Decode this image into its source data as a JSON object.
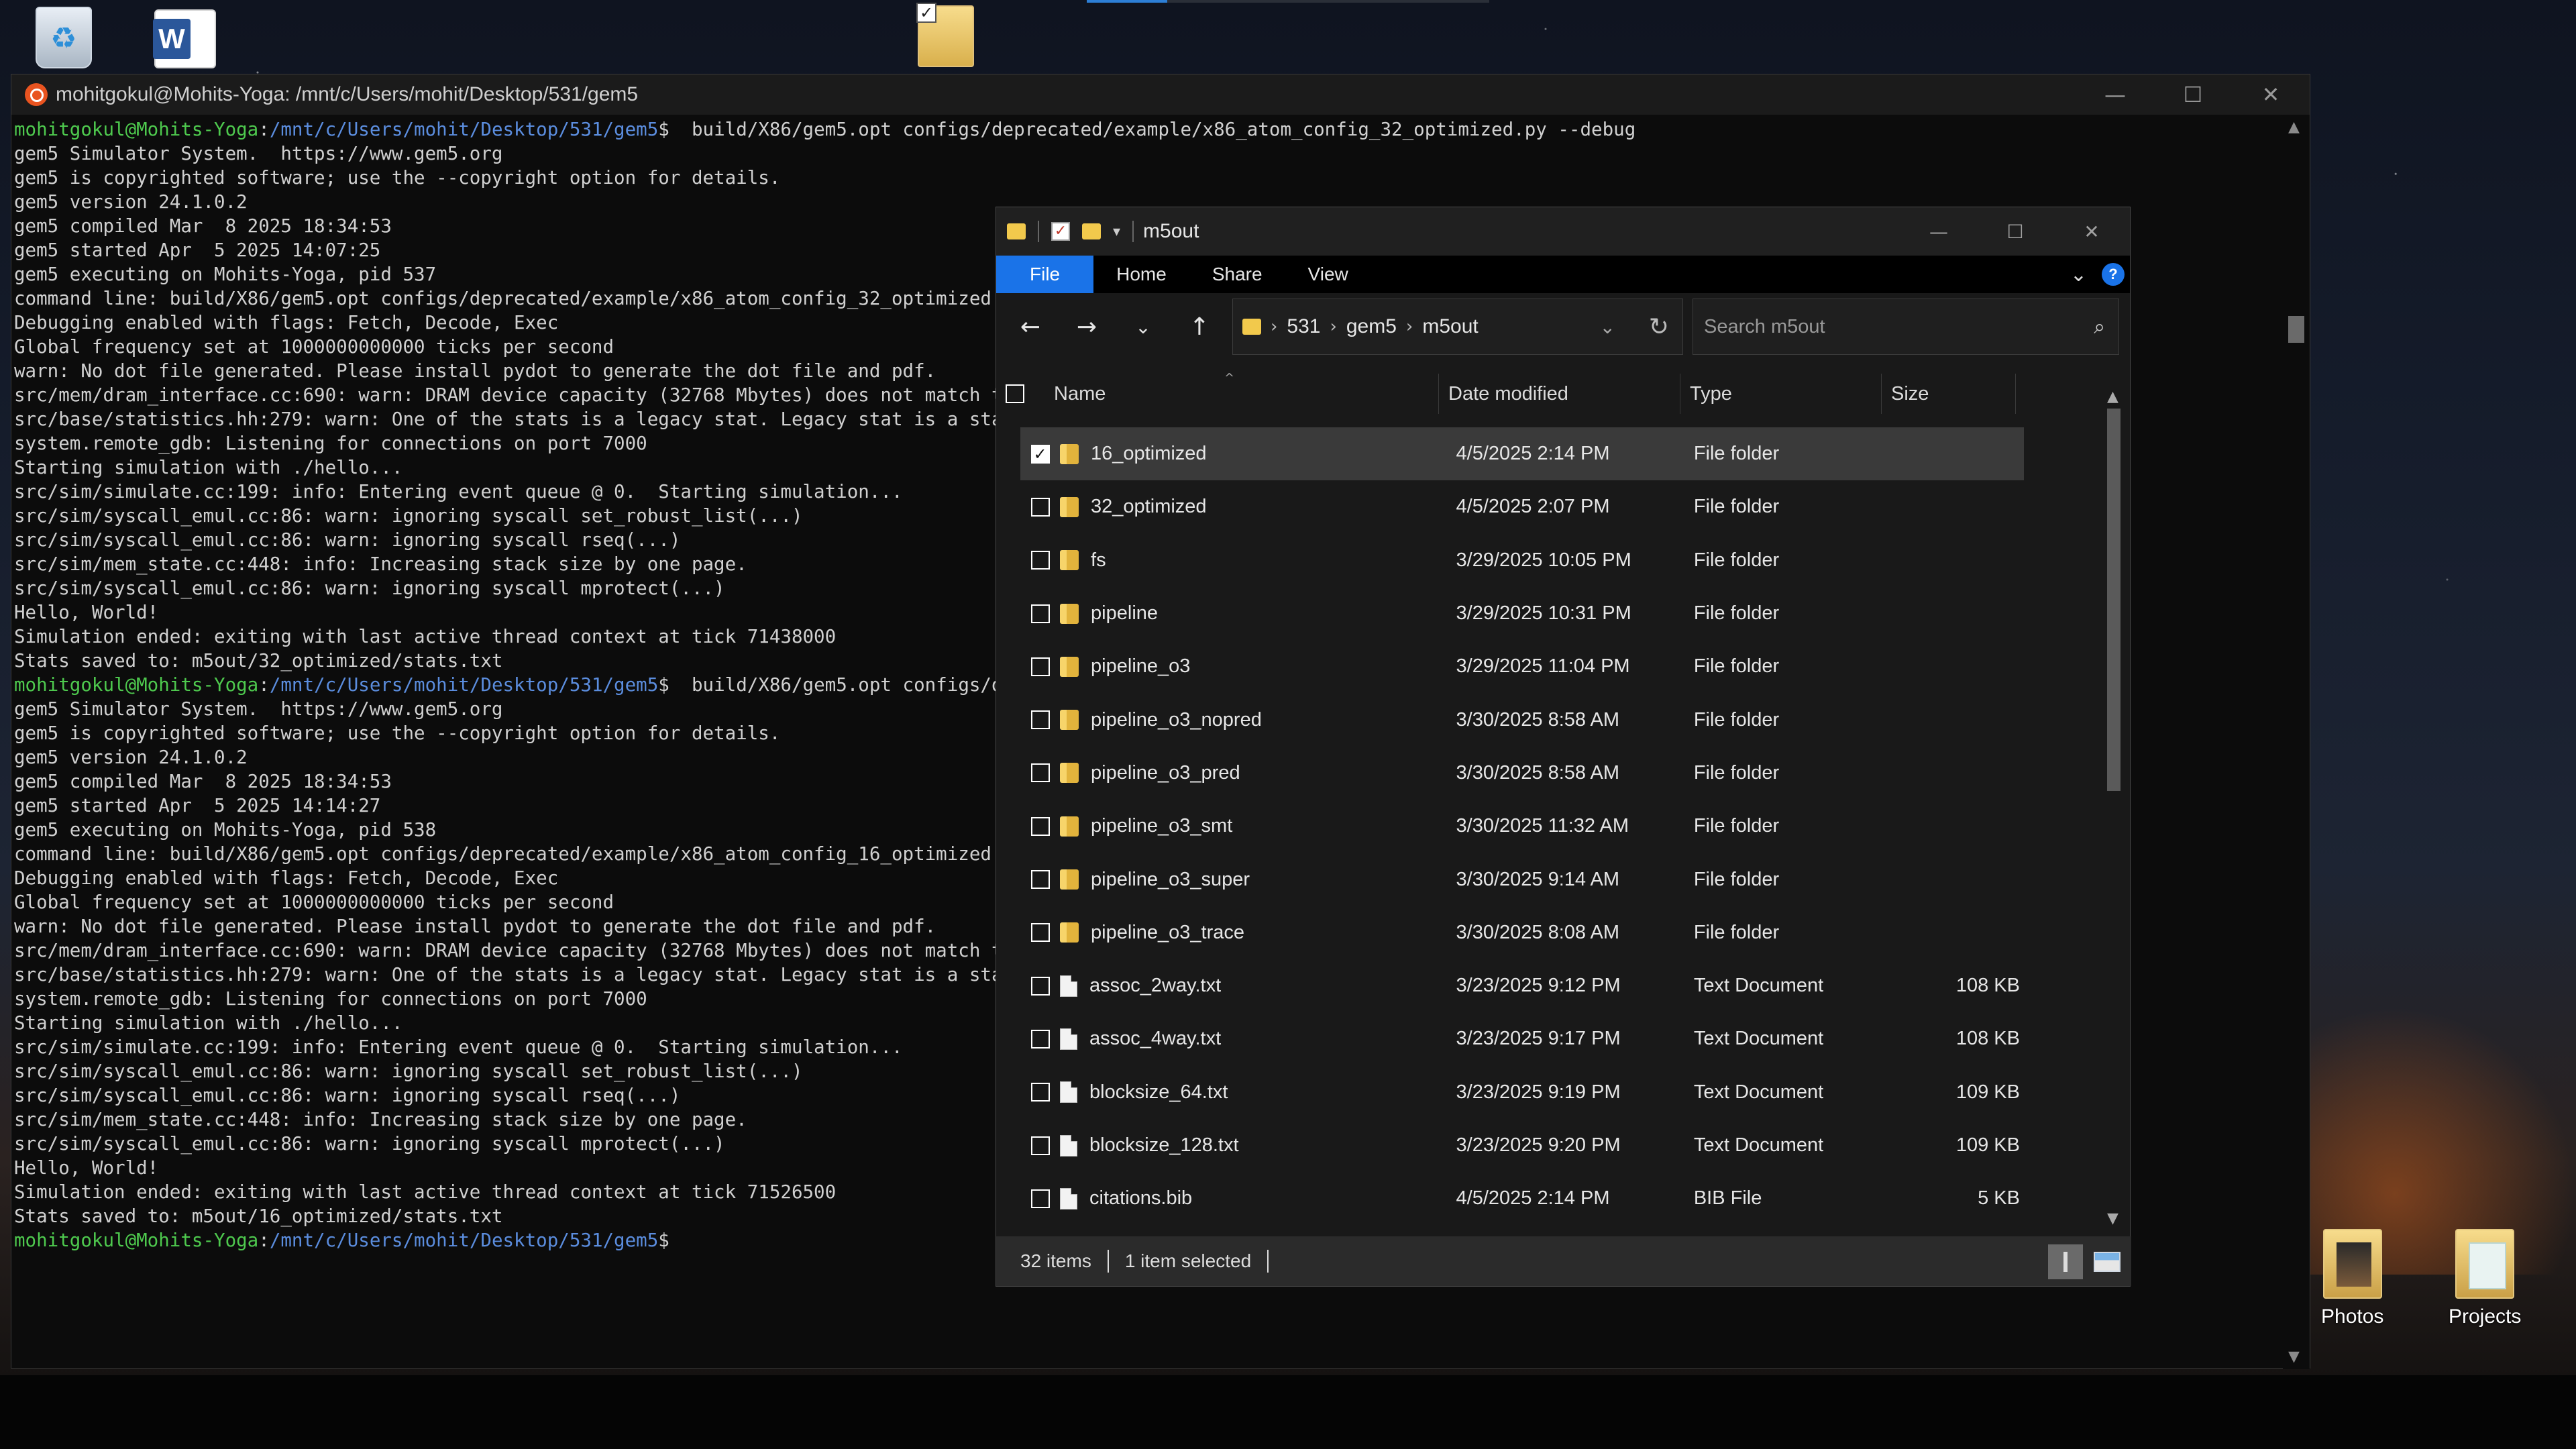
{
  "desktop": {
    "icons": [
      {
        "label": "Photos"
      },
      {
        "label": "Projects"
      }
    ]
  },
  "terminal": {
    "title": "mohitgokul@Mohits-Yoga: /mnt/c/Users/mohit/Desktop/531/gem5",
    "prompt_user": "mohitgokul@Mohits-Yoga",
    "prompt_path": "/mnt/c/Users/mohit/Desktop/531/gem5",
    "lines": [
      {
        "prompt": true,
        "cmd": "$  build/X86/gem5.opt configs/deprecated/example/x86_atom_config_32_optimized.py --debug"
      },
      {
        "text": "gem5 Simulator System.  https://www.gem5.org"
      },
      {
        "text": "gem5 is copyrighted software; use the --copyright option for details."
      },
      {
        "text": ""
      },
      {
        "text": "gem5 version 24.1.0.2"
      },
      {
        "text": "gem5 compiled Mar  8 2025 18:34:53"
      },
      {
        "text": "gem5 started Apr  5 2025 14:07:25"
      },
      {
        "text": "gem5 executing on Mohits-Yoga, pid 537"
      },
      {
        "text": "command line: build/X86/gem5.opt configs/deprecated/example/x86_atom_config_32_optimized.py"
      },
      {
        "text": ""
      },
      {
        "text": "Debugging enabled with flags: Fetch, Decode, Exec"
      },
      {
        "text": "Global frequency set at 1000000000000 ticks per second"
      },
      {
        "text": "warn: No dot file generated. Please install pydot to generate the dot file and pdf."
      },
      {
        "text": "src/mem/dram_interface.cc:690: warn: DRAM device capacity (32768 Mbytes) does not match the"
      },
      {
        "text": "src/base/statistics.hh:279: warn: One of the stats is a legacy stat. Legacy stat is a stat t"
      },
      {
        "text": "system.remote_gdb: Listening for connections on port 7000"
      },
      {
        "text": "Starting simulation with ./hello..."
      },
      {
        "text": "src/sim/simulate.cc:199: info: Entering event queue @ 0.  Starting simulation..."
      },
      {
        "text": "src/sim/syscall_emul.cc:86: warn: ignoring syscall set_robust_list(...)"
      },
      {
        "text": "src/sim/syscall_emul.cc:86: warn: ignoring syscall rseq(...)"
      },
      {
        "text": "src/sim/mem_state.cc:448: info: Increasing stack size by one page."
      },
      {
        "text": "src/sim/syscall_emul.cc:86: warn: ignoring syscall mprotect(...)"
      },
      {
        "text": "Hello, World!"
      },
      {
        "text": "Simulation ended: exiting with last active thread context at tick 71438000"
      },
      {
        "text": "Stats saved to: m5out/32_optimized/stats.txt"
      },
      {
        "prompt": true,
        "cmd": "$  build/X86/gem5.opt configs/depr"
      },
      {
        "text": "gem5 Simulator System.  https://www.gem5.org"
      },
      {
        "text": "gem5 is copyrighted software; use the --copyright option for details."
      },
      {
        "text": ""
      },
      {
        "text": "gem5 version 24.1.0.2"
      },
      {
        "text": "gem5 compiled Mar  8 2025 18:34:53"
      },
      {
        "text": "gem5 started Apr  5 2025 14:14:27"
      },
      {
        "text": "gem5 executing on Mohits-Yoga, pid 538"
      },
      {
        "text": "command line: build/X86/gem5.opt configs/deprecated/example/x86_atom_config_16_optimized.py"
      },
      {
        "text": ""
      },
      {
        "text": "Debugging enabled with flags: Fetch, Decode, Exec"
      },
      {
        "text": "Global frequency set at 1000000000000 ticks per second"
      },
      {
        "text": "warn: No dot file generated. Please install pydot to generate the dot file and pdf."
      },
      {
        "text": "src/mem/dram_interface.cc:690: warn: DRAM device capacity (32768 Mbytes) does not match the"
      },
      {
        "text": "src/base/statistics.hh:279: warn: One of the stats is a legacy stat. Legacy stat is a stat t"
      },
      {
        "text": "system.remote_gdb: Listening for connections on port 7000"
      },
      {
        "text": "Starting simulation with ./hello..."
      },
      {
        "text": "src/sim/simulate.cc:199: info: Entering event queue @ 0.  Starting simulation..."
      },
      {
        "text": "src/sim/syscall_emul.cc:86: warn: ignoring syscall set_robust_list(...)"
      },
      {
        "text": "src/sim/syscall_emul.cc:86: warn: ignoring syscall rseq(...)"
      },
      {
        "text": "src/sim/mem_state.cc:448: info: Increasing stack size by one page."
      },
      {
        "text": "src/sim/syscall_emul.cc:86: warn: ignoring syscall mprotect(...)"
      },
      {
        "text": "Hello, World!"
      },
      {
        "text": "Simulation ended: exiting with last active thread context at tick 71526500"
      },
      {
        "text": "Stats saved to: m5out/16_optimized/stats.txt"
      },
      {
        "prompt": true,
        "cmd": "$"
      }
    ]
  },
  "explorer": {
    "window_title": "m5out",
    "ribbon_tabs": [
      "File",
      "Home",
      "Share",
      "View"
    ],
    "help_label": "?",
    "breadcrumb": [
      "531",
      "gem5",
      "m5out"
    ],
    "search_placeholder": "Search m5out",
    "columns": {
      "name": "Name",
      "date": "Date modified",
      "type": "Type",
      "size": "Size"
    },
    "files": [
      {
        "name": "16_optimized",
        "date": "4/5/2025 2:14 PM",
        "type": "File folder",
        "size": "",
        "kind": "folder",
        "selected": true
      },
      {
        "name": "32_optimized",
        "date": "4/5/2025 2:07 PM",
        "type": "File folder",
        "size": "",
        "kind": "folder"
      },
      {
        "name": "fs",
        "date": "3/29/2025 10:05 PM",
        "type": "File folder",
        "size": "",
        "kind": "folder"
      },
      {
        "name": "pipeline",
        "date": "3/29/2025 10:31 PM",
        "type": "File folder",
        "size": "",
        "kind": "folder"
      },
      {
        "name": "pipeline_o3",
        "date": "3/29/2025 11:04 PM",
        "type": "File folder",
        "size": "",
        "kind": "folder"
      },
      {
        "name": "pipeline_o3_nopred",
        "date": "3/30/2025 8:58 AM",
        "type": "File folder",
        "size": "",
        "kind": "folder"
      },
      {
        "name": "pipeline_o3_pred",
        "date": "3/30/2025 8:58 AM",
        "type": "File folder",
        "size": "",
        "kind": "folder"
      },
      {
        "name": "pipeline_o3_smt",
        "date": "3/30/2025 11:32 AM",
        "type": "File folder",
        "size": "",
        "kind": "folder"
      },
      {
        "name": "pipeline_o3_super",
        "date": "3/30/2025 9:14 AM",
        "type": "File folder",
        "size": "",
        "kind": "folder"
      },
      {
        "name": "pipeline_o3_trace",
        "date": "3/30/2025 8:08 AM",
        "type": "File folder",
        "size": "",
        "kind": "folder"
      },
      {
        "name": "assoc_2way.txt",
        "date": "3/23/2025 9:12 PM",
        "type": "Text Document",
        "size": "108 KB",
        "kind": "doc"
      },
      {
        "name": "assoc_4way.txt",
        "date": "3/23/2025 9:17 PM",
        "type": "Text Document",
        "size": "108 KB",
        "kind": "doc"
      },
      {
        "name": "blocksize_64.txt",
        "date": "3/23/2025 9:19 PM",
        "type": "Text Document",
        "size": "109 KB",
        "kind": "doc"
      },
      {
        "name": "blocksize_128.txt",
        "date": "3/23/2025 9:20 PM",
        "type": "Text Document",
        "size": "109 KB",
        "kind": "doc"
      },
      {
        "name": "citations.bib",
        "date": "4/5/2025 2:14 PM",
        "type": "BIB File",
        "size": "5 KB",
        "kind": "doc"
      }
    ],
    "status": {
      "items": "32 items",
      "selected": "1 item selected"
    }
  }
}
